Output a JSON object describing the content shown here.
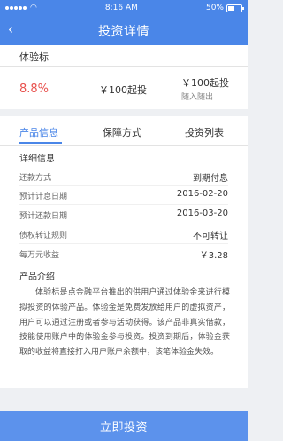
{
  "status_bar": {
    "time": "8:16 AM",
    "battery": "50%"
  },
  "nav": {
    "title": "投资详情"
  },
  "summary": {
    "label": "体验标",
    "rate": "8.8%",
    "min_invest": "￥100起投",
    "right_min": "￥100起投",
    "right_sub": "随入随出"
  },
  "tabs": [
    {
      "label": "产品信息"
    },
    {
      "label": "保障方式"
    },
    {
      "label": "投资列表"
    }
  ],
  "details": {
    "title": "详细信息",
    "rows": [
      {
        "label": "还款方式",
        "value": "到期付息"
      },
      {
        "label": "预计计息日期",
        "value": "2016-02-20"
      },
      {
        "label": "预计还款日期",
        "value": "2016-03-20"
      },
      {
        "label": "债权转让规则",
        "value": "不可转让"
      },
      {
        "label": "每万元收益",
        "value": "￥3.28"
      }
    ]
  },
  "intro": {
    "title": "产品介绍",
    "text": "体验标是点金融平台推出的供用户通过体验金来进行模拟投资的体验产品。体验金是免费发放给用户的虚拟资产，用户可以通过注册或者参与活动获得。该产品非真实借款，技能使用账户中的体验金参与投资。投资到期后，体验金获取的收益将直接打入用户账户余额中，该笔体验金失效。"
  },
  "action": {
    "invest_label": "立即投资"
  }
}
